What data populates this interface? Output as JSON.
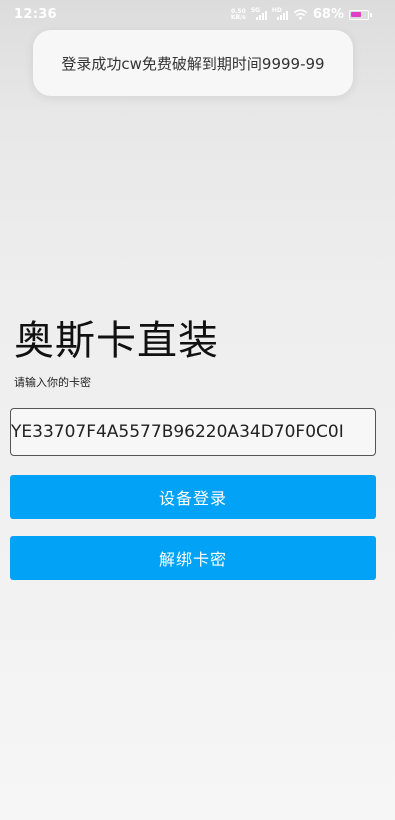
{
  "status_bar": {
    "time": "12:36",
    "net_speed_value": "0.50",
    "net_speed_unit": "KB/s",
    "sim1_tag": "5G",
    "sim2_tag": "HD",
    "battery_percent": "68%",
    "battery_level": 0.68,
    "battery_color": "#e040c8"
  },
  "toast": {
    "message": "登录成功cw免费破解到期时间9999-99"
  },
  "app": {
    "title": "奥斯卡直装",
    "prompt": "请输入你的卡密",
    "key_value": "YE33707F4A5577B96220A34D70F0C0I",
    "login_button": "设备登录",
    "unbind_button": "解绑卡密"
  },
  "colors": {
    "accent": "#02a2f7",
    "toast_bg": "#f7f7f7"
  }
}
